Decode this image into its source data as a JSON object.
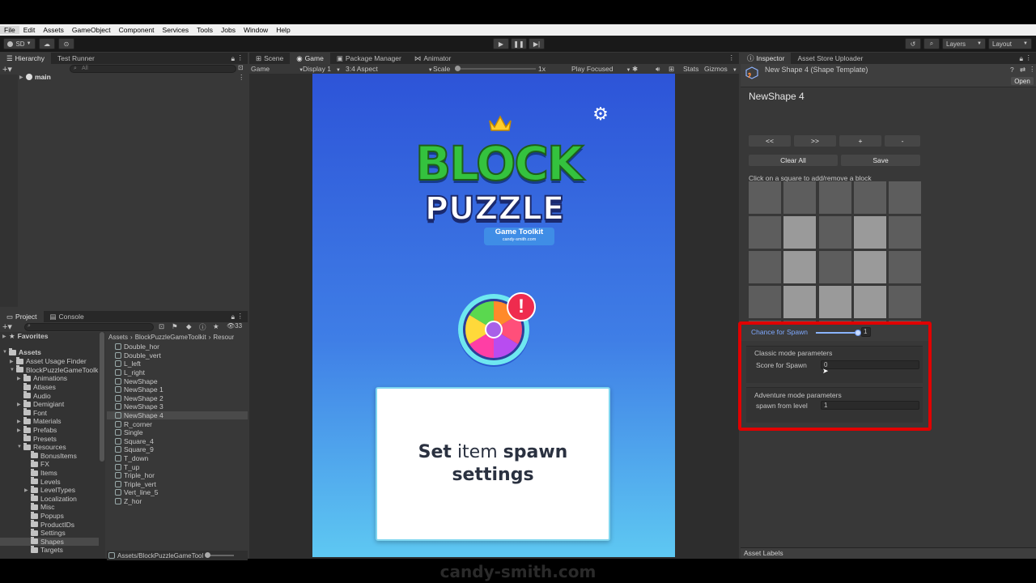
{
  "menu": [
    "File",
    "Edit",
    "Assets",
    "GameObject",
    "Component",
    "Services",
    "Tools",
    "Jobs",
    "Window",
    "Help"
  ],
  "toolbar": {
    "account": "SD",
    "layers": "Layers",
    "layout": "Layout"
  },
  "hierarchy": {
    "tab1": "Hierarchy",
    "tab2": "Test Runner",
    "search_placeholder": "All",
    "scene": "main"
  },
  "scene_tabs": [
    "Scene",
    "Game",
    "Package Manager",
    "Animator"
  ],
  "game_bar": {
    "mode": "Game",
    "display": "Display 1",
    "aspect": "3:4 Aspect",
    "scale_label": "Scale",
    "scale_value": "1x",
    "play_mode": "Play Focused",
    "stats": "Stats",
    "gizmos": "Gizmos"
  },
  "game": {
    "logo_top": "BLOCK",
    "logo_bottom": "PUZZLE",
    "logo_badge": "Game Toolkit",
    "logo_site": "candy-smith.com",
    "alert": "!",
    "card_bold1": "Set",
    "card_regular": " item ",
    "card_bold2": "spawn",
    "card_line2": "settings"
  },
  "project": {
    "tab1": "Project",
    "tab2": "Console",
    "favorites": "Favorites",
    "assets": "Assets",
    "count": "33",
    "breadcrumb": [
      "Assets",
      "BlockPuzzleGameToolkit",
      "Resour"
    ],
    "folders": [
      {
        "label": "Asset Usage Finder",
        "d": 1,
        "a": "▶"
      },
      {
        "label": "BlockPuzzleGameToolk",
        "d": 1,
        "a": "▼"
      },
      {
        "label": "Animations",
        "d": 2,
        "a": "▶"
      },
      {
        "label": "Atlases",
        "d": 2,
        "a": ""
      },
      {
        "label": "Audio",
        "d": 2,
        "a": ""
      },
      {
        "label": "Demigiant",
        "d": 2,
        "a": "▶"
      },
      {
        "label": "Font",
        "d": 2,
        "a": ""
      },
      {
        "label": "Materials",
        "d": 2,
        "a": "▶"
      },
      {
        "label": "Prefabs",
        "d": 2,
        "a": "▶"
      },
      {
        "label": "Presets",
        "d": 2,
        "a": ""
      },
      {
        "label": "Resources",
        "d": 2,
        "a": "▼"
      },
      {
        "label": "BonusItems",
        "d": 3,
        "a": ""
      },
      {
        "label": "FX",
        "d": 3,
        "a": ""
      },
      {
        "label": "Items",
        "d": 3,
        "a": ""
      },
      {
        "label": "Levels",
        "d": 3,
        "a": ""
      },
      {
        "label": "LevelTypes",
        "d": 3,
        "a": "▶"
      },
      {
        "label": "Localization",
        "d": 3,
        "a": ""
      },
      {
        "label": "Misc",
        "d": 3,
        "a": ""
      },
      {
        "label": "Popups",
        "d": 3,
        "a": ""
      },
      {
        "label": "ProductIDs",
        "d": 3,
        "a": ""
      },
      {
        "label": "Settings",
        "d": 3,
        "a": ""
      },
      {
        "label": "Shapes",
        "d": 3,
        "a": "",
        "sel": true
      },
      {
        "label": "Targets",
        "d": 3,
        "a": ""
      }
    ],
    "files": [
      "Double_hor",
      "Double_vert",
      "L_left",
      "L_right",
      "NewShape",
      "NewShape 1",
      "NewShape 2",
      "NewShape 3",
      "NewShape 4",
      "R_corner",
      "Single",
      "Square_4",
      "Square_9",
      "T_down",
      "T_up",
      "Triple_hor",
      "Triple_vert",
      "Vert_line_5",
      "Z_hor"
    ],
    "selected_file": "NewShape 4",
    "footer_path": "Assets/BlockPuzzleGameTool"
  },
  "inspector": {
    "tab1": "Inspector",
    "tab2": "Asset Store Uploader",
    "asset_title": "New Shape 4 (Shape Template)",
    "open": "Open",
    "shape_name": "NewShape 4",
    "nav_buttons": [
      "<<",
      ">>",
      "+",
      "-"
    ],
    "clear_all": "Clear All",
    "save": "Save",
    "hint": "Click on a square to add/remove a block",
    "grid": [
      [
        0,
        0,
        0,
        0,
        0
      ],
      [
        0,
        1,
        0,
        1,
        0
      ],
      [
        0,
        1,
        0,
        1,
        0
      ],
      [
        0,
        1,
        1,
        1,
        0
      ],
      [
        0,
        0,
        0,
        0,
        0
      ]
    ],
    "chance_label": "Chance for Spawn",
    "chance_value": "1",
    "chance_fraction": 1.0,
    "classic_header": "Classic mode parameters",
    "score_label": "Score for Spawn",
    "score_value": "0",
    "adventure_header": "Adventure mode parameters",
    "level_label": "spawn from level",
    "level_value": "1",
    "asset_labels": "Asset Labels"
  },
  "watermark": "candy-smith.com",
  "colors": {
    "highlight": "#e00000",
    "cell_on": "#9a9a9a",
    "cell_off": "#5d5d5d"
  }
}
